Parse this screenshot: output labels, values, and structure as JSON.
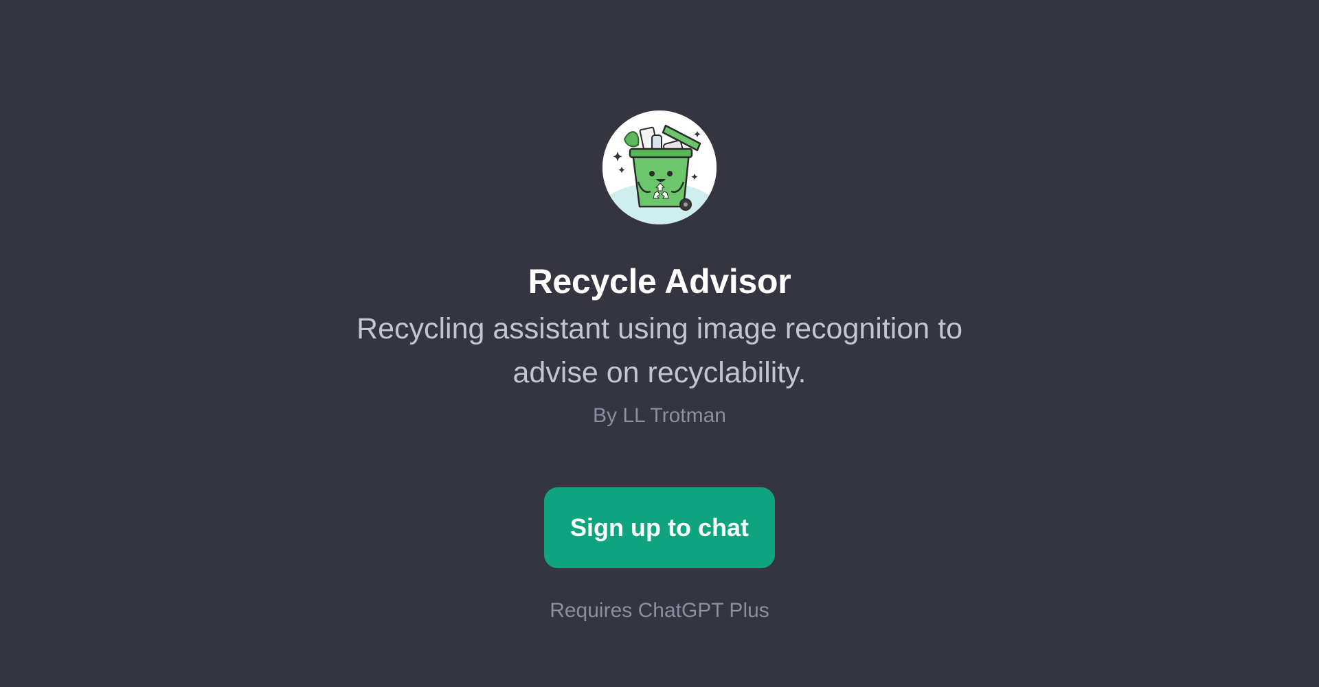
{
  "gpt": {
    "name": "Recycle Advisor",
    "description": "Recycling assistant using image recognition to advise on recyclability.",
    "author": "By LL Trotman",
    "avatar_icon": "recycle-bin-mascot-icon"
  },
  "cta": {
    "label": "Sign up to chat"
  },
  "footer": {
    "requirement": "Requires ChatGPT Plus"
  },
  "colors": {
    "background": "#343541",
    "accent": "#10a37f",
    "title": "#ffffff",
    "description": "#c5c5d2",
    "muted": "#8e8ea0"
  }
}
